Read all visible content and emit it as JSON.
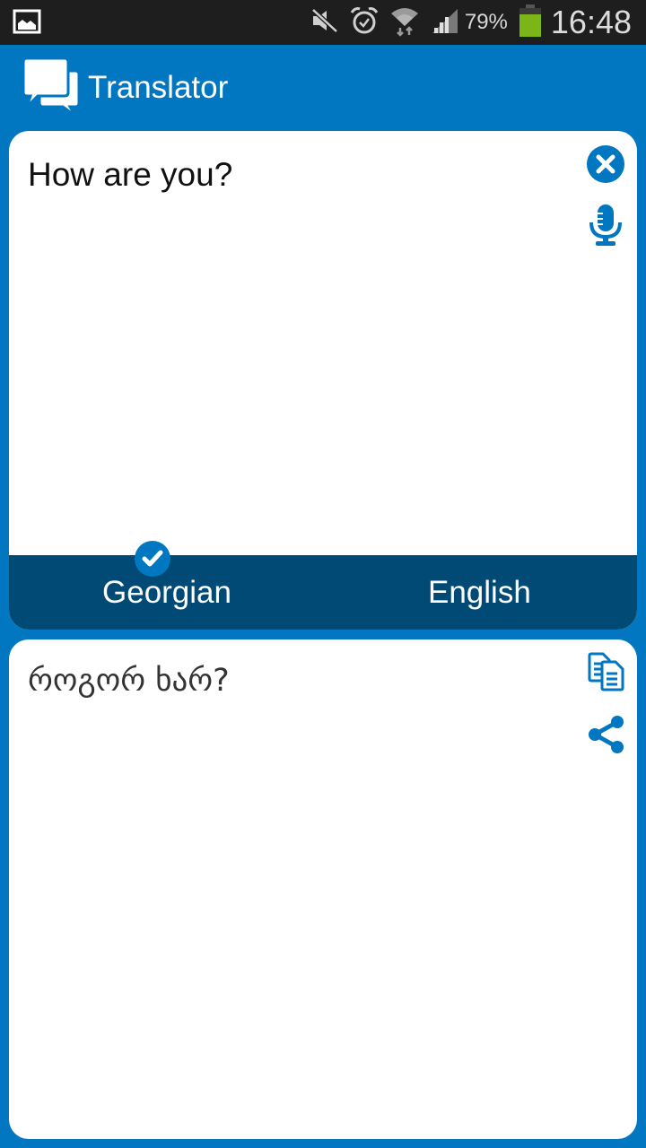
{
  "status_bar": {
    "notification_icon": "image-icon",
    "icons": [
      "mute-icon",
      "alarm-icon",
      "wifi-icon",
      "signal-icon"
    ],
    "battery_percent": "79%",
    "battery_color": "#7cb518",
    "time": "16:48"
  },
  "app": {
    "title": "Translator",
    "logo_icon": "chat-bubbles-icon",
    "accent_color": "#0077c0",
    "lang_bar_color": "#004a75"
  },
  "source": {
    "text": "How are you?",
    "clear_icon": "clear-icon",
    "mic_icon": "microphone-icon"
  },
  "languages": {
    "source": "Georgian",
    "target": "English",
    "selected": "Georgian",
    "selected_icon": "checkmark-icon"
  },
  "target": {
    "text": "როგორ ხარ?",
    "copy_icon": "copy-icon",
    "share_icon": "share-icon"
  }
}
